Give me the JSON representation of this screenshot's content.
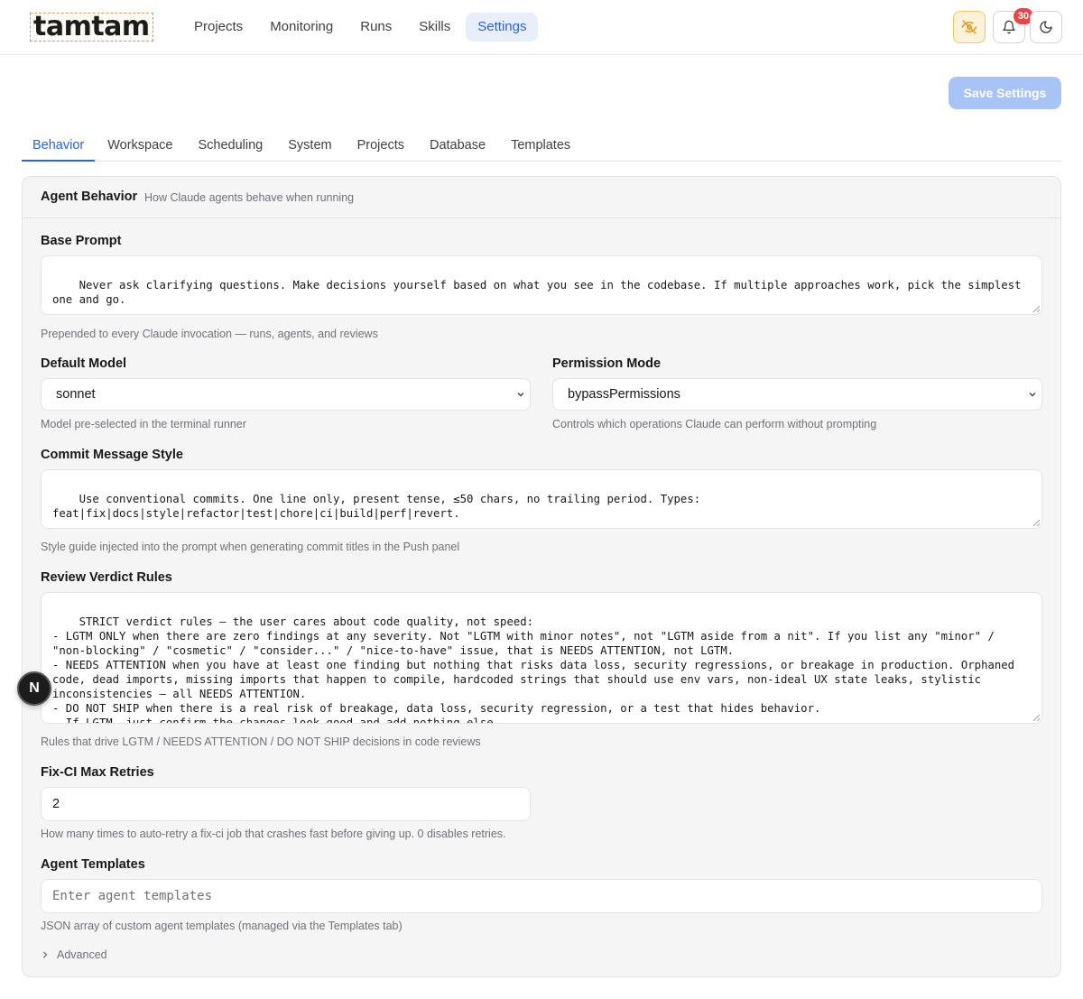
{
  "app": {
    "logo_text": "tamtam",
    "nav": [
      "Projects",
      "Monitoring",
      "Runs",
      "Skills",
      "Settings"
    ],
    "active_nav": "Settings",
    "notifications_count": "30",
    "colors": {
      "accent": "#2563eb",
      "warn": "#fdf1d8",
      "badge": "#ef4444"
    }
  },
  "toolbar": {
    "save_label": "Save Settings"
  },
  "tabs": [
    "Behavior",
    "Workspace",
    "Scheduling",
    "System",
    "Projects",
    "Database",
    "Templates"
  ],
  "active_tab": "Behavior",
  "card": {
    "title": "Agent Behavior",
    "subtitle": "How Claude agents behave when running"
  },
  "fields": {
    "base_prompt": {
      "label": "Base Prompt",
      "value": "Never ask clarifying questions. Make decisions yourself based on what you see in the codebase. If multiple approaches work, pick the simplest one and go.",
      "help": "Prepended to every Claude invocation — runs, agents, and reviews"
    },
    "default_model": {
      "label": "Default Model",
      "value": "sonnet",
      "help": "Model pre-selected in the terminal runner"
    },
    "permission_mode": {
      "label": "Permission Mode",
      "value": "bypassPermissions",
      "help": "Controls which operations Claude can perform without prompting"
    },
    "commit_style": {
      "label": "Commit Message Style",
      "value": "Use conventional commits. One line only, present tense, ≤50 chars, no trailing period. Types:\nfeat|fix|docs|style|refactor|test|chore|ci|build|perf|revert.",
      "help": "Style guide injected into the prompt when generating commit titles in the Push panel"
    },
    "review_rules": {
      "label": "Review Verdict Rules",
      "value": "STRICT verdict rules — the user cares about code quality, not speed:\n- LGTM ONLY when there are zero findings at any severity. Not \"LGTM with minor notes\", not \"LGTM aside from a nit\". If you list any \"minor\" / \"non-blocking\" / \"cosmetic\" / \"consider...\" / \"nice-to-have\" issue, that is NEEDS ATTENTION, not LGTM.\n- NEEDS ATTENTION when you have at least one finding but nothing that risks data loss, security regressions, or breakage in production. Orphaned code, dead imports, missing imports that happen to compile, hardcoded strings that should use env vars, non-ideal UX state leaks, stylistic inconsistencies — all NEEDS ATTENTION.\n- DO NOT SHIP when there is a real risk of breakage, data loss, security regression, or a test that hides behavior.\n- If LGTM, just confirm the changes look good and add nothing else.",
      "help": "Rules that drive LGTM / NEEDS ATTENTION / DO NOT SHIP decisions in code reviews"
    },
    "fix_ci_retries": {
      "label": "Fix-CI Max Retries",
      "value": "2",
      "help": "How many times to auto-retry a fix-ci job that crashes fast before giving up. 0 disables retries."
    },
    "agent_templates": {
      "label": "Agent Templates",
      "placeholder": "Enter agent templates",
      "help": "JSON array of custom agent templates (managed via the Templates tab)"
    }
  },
  "advanced_label": "Advanced",
  "floating_badge": "N"
}
